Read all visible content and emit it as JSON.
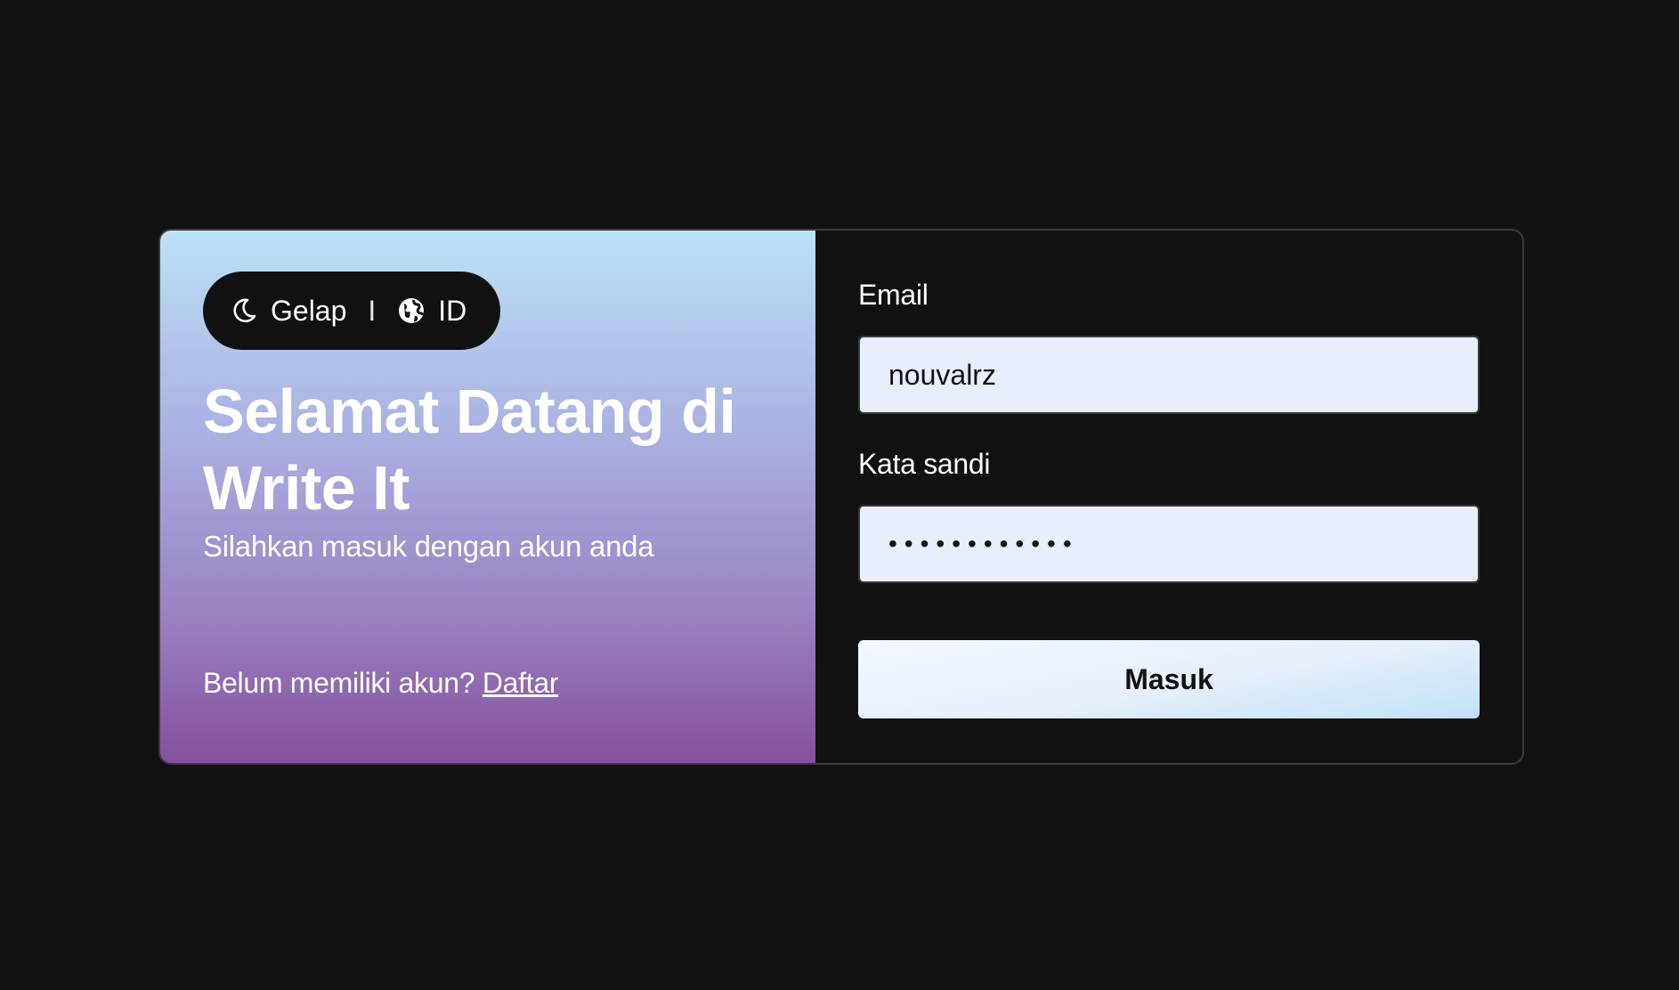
{
  "theme_toggle": {
    "theme_label": "Gelap",
    "separator": "I",
    "language_label": "ID",
    "theme_icon": "moon-icon",
    "language_icon": "globe-icon"
  },
  "hero": {
    "title": "Selamat Datang di Write It",
    "subtitle": "Silahkan masuk dengan akun anda",
    "register_prompt": "Belum memiliki akun?",
    "register_link": "Daftar"
  },
  "form": {
    "email_label": "Email",
    "email_value": "nouvalrz",
    "password_label": "Kata sandi",
    "password_value": "............",
    "submit_label": "Masuk"
  },
  "colors": {
    "background": "#111111",
    "input_background": "#e8eefb",
    "gradient_top": "#bde1f8",
    "gradient_bottom": "#85509e"
  }
}
